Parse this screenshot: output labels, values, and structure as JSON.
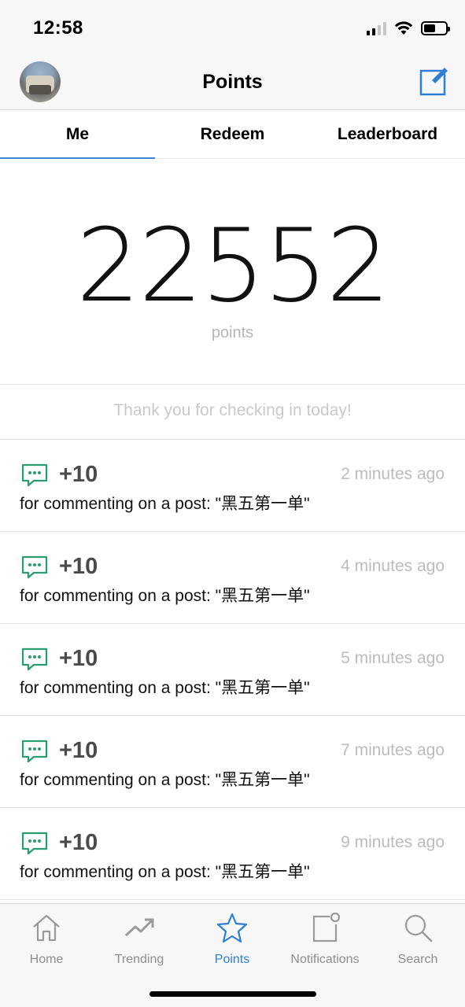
{
  "status_bar": {
    "time": "12:58",
    "battery_level": 0.55,
    "signal_bars": 2
  },
  "nav": {
    "title": "Points",
    "avatar_icon": "user-avatar-icon",
    "compose_icon": "compose-icon",
    "accent_color": "#2f7fd3"
  },
  "tabs": [
    {
      "label": "Me",
      "active": true
    },
    {
      "label": "Redeem",
      "active": false
    },
    {
      "label": "Leaderboard",
      "active": false
    }
  ],
  "summary": {
    "points": "22552",
    "points_label": "points",
    "checkin_message": "Thank you for checking in today!"
  },
  "activity": [
    {
      "icon": "comment-icon",
      "points": "+10",
      "time": "2 minutes ago",
      "description": "for commenting on a post: \"黑五第一单\""
    },
    {
      "icon": "comment-icon",
      "points": "+10",
      "time": "4 minutes ago",
      "description": "for commenting on a post: \"黑五第一单\""
    },
    {
      "icon": "comment-icon",
      "points": "+10",
      "time": "5 minutes ago",
      "description": "for commenting on a post: \"黑五第一单\""
    },
    {
      "icon": "comment-icon",
      "points": "+10",
      "time": "7 minutes ago",
      "description": "for commenting on a post: \"黑五第一单\""
    },
    {
      "icon": "comment-icon",
      "points": "+10",
      "time": "9 minutes ago",
      "description": "for commenting on a post: \"黑五第一单\""
    }
  ],
  "activity_icon_color": "#2a9d6e",
  "tab_bar": [
    {
      "label": "Home",
      "icon": "home-icon",
      "active": false
    },
    {
      "label": "Trending",
      "icon": "trending-icon",
      "active": false
    },
    {
      "label": "Points",
      "icon": "star-icon",
      "active": true
    },
    {
      "label": "Notifications",
      "icon": "notifications-icon",
      "active": false
    },
    {
      "label": "Search",
      "icon": "search-icon",
      "active": false
    }
  ]
}
